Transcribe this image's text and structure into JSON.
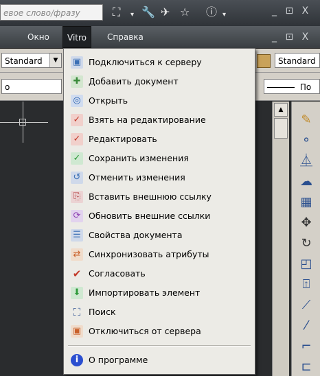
{
  "search": {
    "text": "евое слово/фразу"
  },
  "titlebar": {
    "icons": [
      "binoculars-icon",
      "wrench-icon",
      "satellite-icon",
      "star-icon",
      "help-icon"
    ],
    "window_controls": "_ ⊡ X"
  },
  "menubar": {
    "items": [
      {
        "label": "Окно"
      },
      {
        "label": "Vitro"
      },
      {
        "label": "Справка"
      }
    ],
    "window_controls": "_ ⊡ X"
  },
  "toolbar": {
    "style_combo": "Standard",
    "dimstyle_combo": "Standard",
    "layer_combo": "o",
    "linetype_combo": "По"
  },
  "menu": {
    "title": "Vitro",
    "items": [
      {
        "label": "Подключиться к серверу",
        "icon": "server-connect-icon",
        "color": "#3a6fb5"
      },
      {
        "label": "Добавить документ",
        "icon": "add-document-icon",
        "color": "#3a8a3a"
      },
      {
        "label": "Открыть",
        "icon": "open-search-icon",
        "color": "#2b62b0"
      },
      {
        "label": "Взять на редактирование",
        "icon": "checkout-edit-icon",
        "color": "#c23a2a"
      },
      {
        "label": "Редактировать",
        "icon": "edit-icon",
        "color": "#c23a2a"
      },
      {
        "label": "Сохранить изменения",
        "icon": "save-changes-icon",
        "color": "#2f9a3a"
      },
      {
        "label": "Отменить изменения",
        "icon": "cancel-changes-icon",
        "color": "#3a6fb5"
      },
      {
        "label": "Вставить внешнюю ссылку",
        "icon": "insert-xref-icon",
        "color": "#b03a3a"
      },
      {
        "label": "Обновить внешние ссылки",
        "icon": "update-xrefs-icon",
        "color": "#8a3ab0"
      },
      {
        "label": "Свойства документа",
        "icon": "document-properties-icon",
        "color": "#3a6fb5"
      },
      {
        "label": "Синхронизовать атрибуты",
        "icon": "sync-attributes-icon",
        "color": "#c9602a"
      },
      {
        "label": "Согласовать",
        "icon": "approve-icon",
        "color": "#c23a2a"
      },
      {
        "label": "Импортировать элемент",
        "icon": "import-element-icon",
        "color": "#2f9a3a"
      },
      {
        "label": "Поиск",
        "icon": "search-binoculars-icon",
        "color": "#2b4f90"
      },
      {
        "label": "Отключиться от сервера",
        "icon": "server-disconnect-icon",
        "color": "#c9602a"
      },
      {
        "label": "О программе",
        "icon": "about-icon",
        "color": "#2b4fd0"
      }
    ]
  },
  "modify_toolbar": {
    "icons": [
      "erase-icon",
      "copy-icon",
      "mirror-icon",
      "offset-icon",
      "array-icon",
      "move-icon",
      "rotate-icon",
      "scale-icon",
      "stretch-icon",
      "trim-icon",
      "extend-icon",
      "break-icon",
      "join-icon"
    ]
  }
}
